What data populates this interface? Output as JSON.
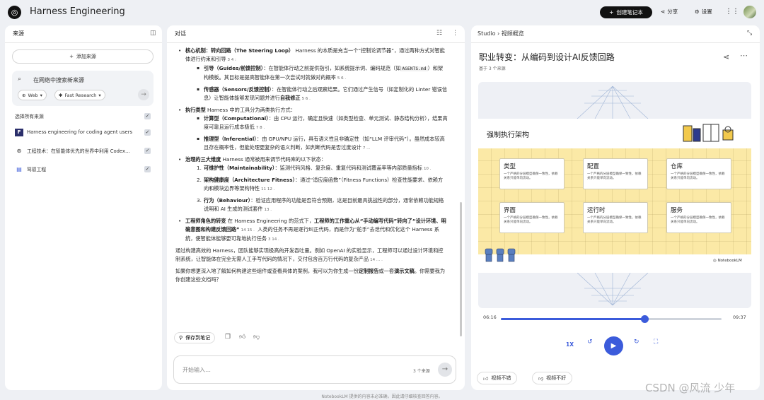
{
  "app": {
    "title": "Harness Engineering",
    "create_label": "创建笔记本",
    "share_label": "分享",
    "settings_label": "设置"
  },
  "sources": {
    "header": "来源",
    "add_label": "添加来源",
    "search_placeholder": "在网络中搜索新来源",
    "web_chip": "Web",
    "research_chip": "Fast Research",
    "select_all_label": "选择所有来源",
    "items": [
      {
        "label": "Harness engineering for coding agent users",
        "icon": "F"
      },
      {
        "label": "工程技术：在智能体优先的世界中利用 Codex…",
        "icon": "⊛"
      },
      {
        "label": "驾驭工程",
        "icon": "▤"
      }
    ]
  },
  "chat": {
    "header": "对话",
    "s1_title": "核心机制：转向回路（The Steering Loop）",
    "s1_text": " Harness 的本质是充当一个“控制论调节器”，通过两种方式对智能体进行约束和引导",
    "s1_cite": "3  4  :",
    "guide_title": "引导（Guides/前馈控制）",
    "guide_text": "：在智能体行动之前提供指引，如系统提示词、编码规范（如",
    "guide_code": "AGENTS.md",
    "guide_text2": "）和架构模板。其目标是提高智能体在第一次尝试时就做对的概率",
    "guide_cite": "5  6 .",
    "sensor_title": "传感器（Sensors/反馈控制）",
    "sensor_text": "：在智能体行动之后观察结果。它们通过产生信号（如定制化的 Linter 错误信息）让智能体能够发现问题并进行",
    "sensor_bold": "自我修正",
    "sensor_cite": "5  6 .",
    "s2_title": "执行类型",
    "s2_text": " Harness 中的工具分为两类执行方式：",
    "comp_title": "计算型（Computational）",
    "comp_text": "：由 CPU 运行，确定且快速（如类型检查、单元测试、静态结构分析），结果高度可靠且运行成本极低",
    "comp_cite": "7  8 .",
    "inf_title": "推理型（Inferential）",
    "inf_text": "：由 GPU/NPU 运行，具有语义性且非确定性（如“LLM 评审代码”）。虽然成本较高且存在概率性，但能处理更复杂的语义判断，如判断代码是否过度设计",
    "inf_cite": "7  …",
    "s3_title": "治理的三大维度",
    "s3_text": " Harness 通常被用来调节代码库的以下状态：",
    "n1_title": "可维护性（Maintainability）",
    "n1_text": "：监测代码风格、复杂度、重复代码和测试覆盖率等内部质量指标",
    "n1_cite": "10 .",
    "n2_title": "架构健康度（Architecture Fitness）",
    "n2_text": "：通过“适应度函数”（Fitness Functions）检查性能要求、依赖方向和模块边界等架构特性",
    "n2_cite": "11  12 .",
    "n3_title": "行为（Behaviour）",
    "n3_text": "：验证应用程序的功能是否符合预期，这是目前最具挑战性的部分，通常依赖功能规格说明和 AI 生成的测试套件",
    "n3_cite": "13 .",
    "s4_title": "工程师角色的转变",
    "s4_text": " 在 Harness Engineering 的范式下，",
    "s4_bold": "工程师的工作重心从“手动编写代码”转向了“设计环境、明确意图和构建反馈回路”",
    "s4_cite": "14  15 .",
    "s4_text2": " 人类的任务不再是逐行纠正代码，而是作为“舵手”去迭代和优化这个 Harness 系统，使智能体能够更可靠地执行任务",
    "s4_cite2": "3  14 .",
    "p1": "通过构建高效的 Harness，团队能够实现极高的开发吞吐量。例如 OpenAI 的实验显示，工程师可以通过设计环境和控制系统，让智能体在完全无需人工手写代码的情况下，交付包含百万行代码的复杂产品",
    "p1_cite": "14  … .",
    "p2a": "如果你想更深入地了解如何构建这些组件或查看具体的案例，我可以为你生成一份",
    "p2b": "定制报告",
    "p2c": "或一套",
    "p2d": "演示文稿",
    "p2e": "。你需要我为你创建这些文档吗？",
    "save_note_label": "保存到笔记",
    "input_placeholder": "开始输入…",
    "source_count": "3 个来源"
  },
  "studio": {
    "breadcrumb_root": "Studio",
    "breadcrumb_sep": "›",
    "breadcrumb_leaf": "视频概览",
    "video_title": "职业转变：从编码到设计AI反馈回路",
    "video_subtitle": "基于 3 个来源",
    "slide_title": "强制执行架构",
    "slide_brand": "NotebookLM",
    "cards": [
      {
        "title": "类型",
        "desc": "一个严格的分层模型确保一致性，依赖关系只能单向流动。"
      },
      {
        "title": "配置",
        "desc": "一个严格的分层模型确保一致性，依赖关系只能单向流动。"
      },
      {
        "title": "仓库",
        "desc": "一个严格的分层模型确保一致性，依赖关系只能单向流动。"
      },
      {
        "title": "界面",
        "desc": "一个严格的分层模型确保一致性，依赖关系只能单向流动。"
      },
      {
        "title": "运行时",
        "desc": "一个严格的分层模型确保一致性，依赖关系只能单向流动。"
      },
      {
        "title": "服务",
        "desc": "一个严格的分层模型确保一致性，依赖关系只能单向流动。"
      }
    ],
    "time_current": "06:16",
    "time_total": "09:37",
    "progress": 0.652,
    "speed": "1X",
    "like_label": "视频不错",
    "dislike_label": "视频不好"
  },
  "footer": "NotebookLM 提供的内容未必准确，因此请仔细核查回答内容。",
  "watermark": "CSDN @风流 少年",
  "accent_color": "#3b5bdb"
}
